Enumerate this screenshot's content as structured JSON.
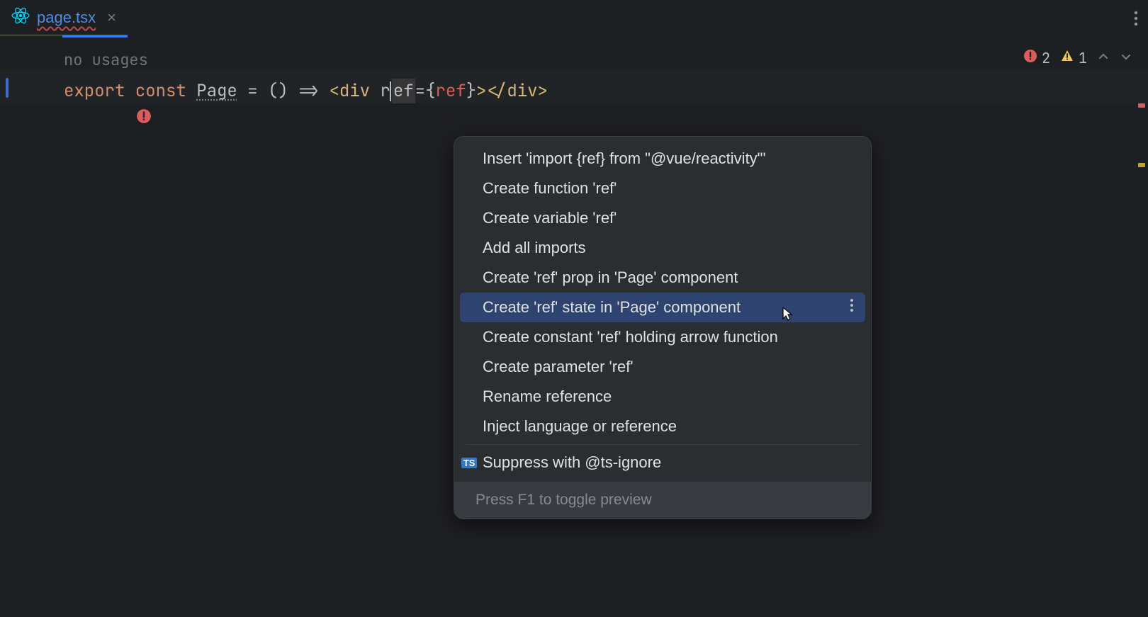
{
  "tab": {
    "filename": "page.tsx"
  },
  "editor": {
    "usages_label": "no usages",
    "code": {
      "export_kw": "export",
      "const_kw": "const",
      "component_name": "Page",
      "equals": " = ",
      "parens": "()",
      "arrow": " => ",
      "open_tag_angle": "<",
      "tag_name": "div",
      "space": " ",
      "attr_name_pre": "r",
      "attr_name_post": "ef",
      "attr_eq": "=",
      "brace_open": "{",
      "ref_var": "ref",
      "brace_close": "}",
      "close_angle": ">",
      "close_tag": "</div>",
      "self_close": ""
    }
  },
  "status": {
    "error_count": "2",
    "warning_count": "1"
  },
  "popup": {
    "items": [
      "Insert 'import {ref} from \"@vue/reactivity\"'",
      "Create function 'ref'",
      "Create variable 'ref'",
      "Add all imports",
      "Create 'ref' prop in 'Page' component",
      "Create 'ref' state in 'Page' component",
      "Create constant 'ref' holding arrow function",
      "Create parameter 'ref'",
      "Rename reference",
      "Inject language or reference"
    ],
    "selected_index": 5,
    "suppress_item": "Suppress with @ts-ignore",
    "footer": "Press F1 to toggle preview"
  }
}
